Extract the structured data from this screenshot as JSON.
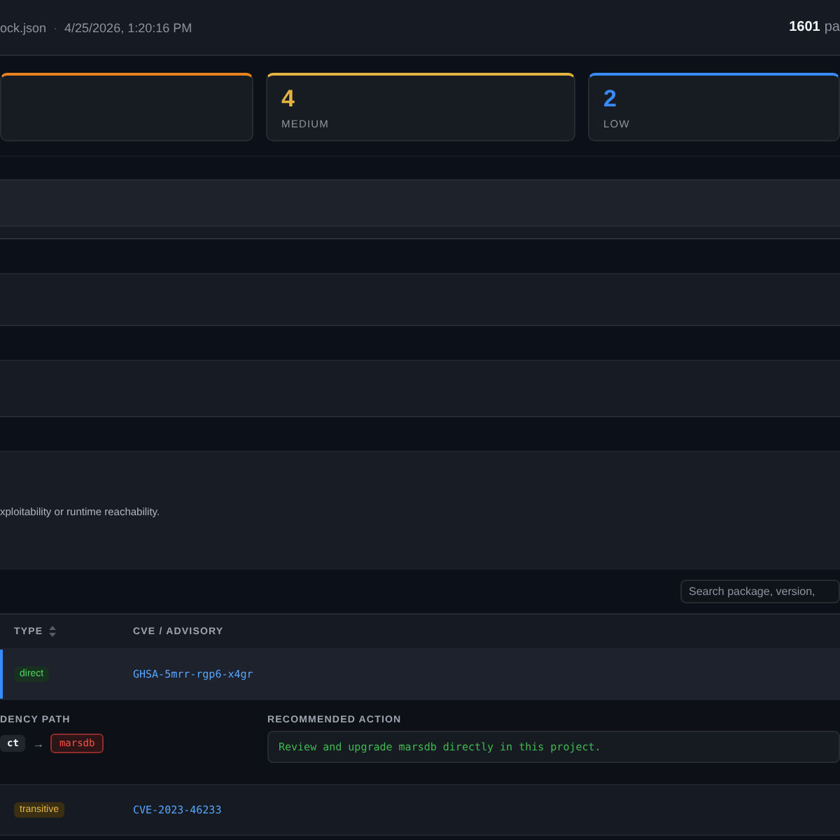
{
  "header": {
    "file": "ock.json",
    "separator": "·",
    "timestamp": "4/25/2026, 1:20:16 PM",
    "package_count": "1601",
    "package_label": "pa"
  },
  "severity_cards": [
    {
      "color": "#e8821e"
    },
    {
      "count": "4",
      "label": "MEDIUM",
      "color": "#e3b341"
    },
    {
      "count": "2",
      "label": "LOW",
      "color": "#388bfd"
    }
  ],
  "note": {
    "text": "xploitability or runtime reachability."
  },
  "search": {
    "placeholder": "Search package, version,"
  },
  "table": {
    "columns": [
      {
        "label": "TYPE",
        "sortable": true
      },
      {
        "label": "CVE / ADVISORY",
        "sortable": false
      }
    ],
    "rows": [
      {
        "type": "direct",
        "kind": "direct",
        "advisory": "GHSA-5mrr-rgp6-x4gr",
        "expanded": true,
        "details": {
          "path_heading": "DENCY PATH",
          "path": [
            {
              "name": "ct",
              "kind": "parent"
            },
            {
              "name": "marsdb",
              "kind": "vulnerable"
            }
          ],
          "path_arrow": "→",
          "action_heading": "RECOMMENDED ACTION",
          "action": "Review and upgrade marsdb directly in this project."
        }
      },
      {
        "type": "transitive",
        "kind": "transitive",
        "advisory": "CVE-2023-46233",
        "expanded": false
      }
    ]
  }
}
